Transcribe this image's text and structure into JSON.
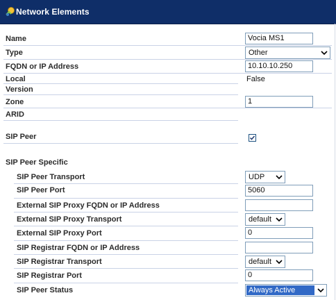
{
  "window": {
    "title": "Network Elements",
    "icon": "network-elements-icon"
  },
  "fields": {
    "name": {
      "label": "Name",
      "value": "Vocia MS1"
    },
    "type": {
      "label": "Type",
      "value": "Other"
    },
    "fqdn": {
      "label": "FQDN or IP Address",
      "value": "10.10.10.250"
    },
    "local": {
      "label": "Local",
      "value": "False"
    },
    "version": {
      "label": "Version"
    },
    "zone": {
      "label": "Zone",
      "value": "1"
    },
    "arid": {
      "label": "ARID"
    },
    "sip_peer": {
      "label": "SIP Peer",
      "checked": true
    },
    "sip_peer_specific": {
      "label": "SIP Peer Specific"
    },
    "sip_peer_transport": {
      "label": "SIP Peer Transport",
      "value": "UDP"
    },
    "sip_peer_port": {
      "label": "SIP Peer Port",
      "value": "5060"
    },
    "ext_proxy_fqdn": {
      "label": "External SIP Proxy FQDN or IP Address",
      "value": ""
    },
    "ext_proxy_transport": {
      "label": "External SIP Proxy Transport",
      "value": "default"
    },
    "ext_proxy_port": {
      "label": "External SIP Proxy Port",
      "value": "0"
    },
    "registrar_fqdn": {
      "label": "SIP Registrar FQDN or IP Address",
      "value": ""
    },
    "registrar_transport": {
      "label": "SIP Registrar Transport",
      "value": "default"
    },
    "registrar_port": {
      "label": "SIP Registrar Port",
      "value": "0"
    },
    "sip_peer_status": {
      "label": "SIP Peer Status",
      "value": "Always Active"
    }
  },
  "colors": {
    "header_bg": "#0f2e68",
    "separator": "#c9d2e6",
    "selection": "#3169c6"
  }
}
